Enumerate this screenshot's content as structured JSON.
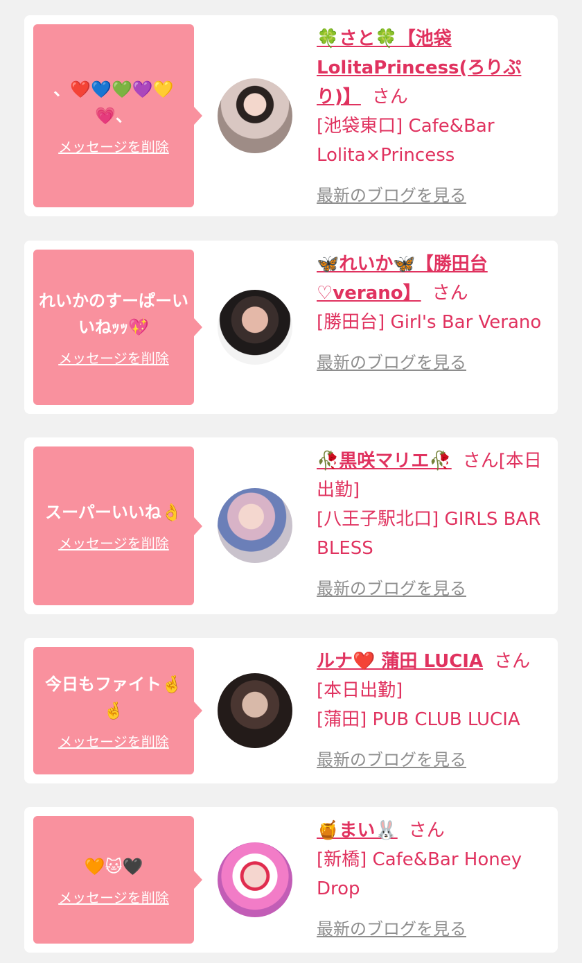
{
  "items": [
    {
      "message": "、❤️💙💚💜💛💗、",
      "delete_label": "メッセージを削除",
      "name": "🍀さと🍀【池袋LolitaPrincess(ろりぷり)】",
      "honorific": "さん",
      "shop": "[池袋東口] Cafe&Bar Lolita×Princess",
      "blog_label": "最新のブログを見る"
    },
    {
      "message": "れいかのすーぱーいいねｯｯ💖",
      "delete_label": "メッセージを削除",
      "name": "🦋れいか🦋【勝田台♡verano】",
      "honorific": "さん",
      "shop": "[勝田台] Girl's Bar Verano",
      "blog_label": "最新のブログを見る"
    },
    {
      "message": "スーパーいいね👌",
      "delete_label": "メッセージを削除",
      "name": "🥀黒咲マリエ🥀",
      "honorific": "さん[本日出勤]",
      "shop": "[八王子駅北口] GIRLS BAR BLESS",
      "blog_label": "最新のブログを見る"
    },
    {
      "message": "今日もファイト🤞🤞",
      "delete_label": "メッセージを削除",
      "name": "ルナ❤️ 蒲田 LUCIA",
      "honorific": "さん[本日出勤]",
      "shop": "[蒲田] PUB CLUB LUCIA",
      "blog_label": "最新のブログを見る"
    },
    {
      "message": "🧡🐱🖤",
      "delete_label": "メッセージを削除",
      "name": "🍯まい🐰",
      "honorific": "さん",
      "shop": "[新橋] Cafe&Bar Honey Drop",
      "blog_label": "最新のブログを見る"
    }
  ]
}
